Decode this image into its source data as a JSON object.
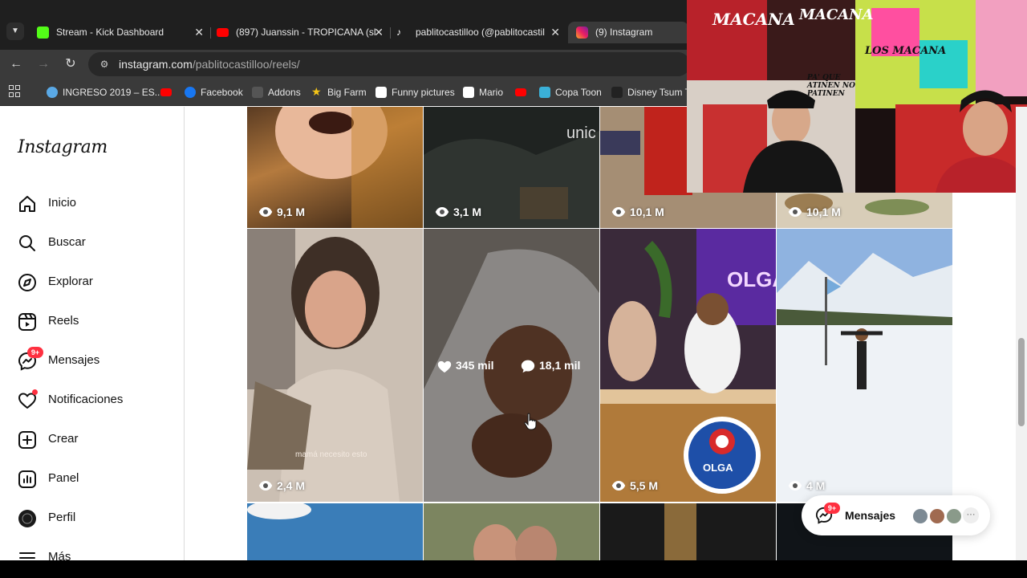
{
  "browser": {
    "tabs": [
      {
        "title": "Stream - Kick Dashboard",
        "favicon": "kick-logo-icon"
      },
      {
        "title": "(897) Juanssin - TROPICANA (sl",
        "favicon": "youtube-logo-icon"
      },
      {
        "title": "pablitocastilloo (@pablitocastil",
        "favicon": "tiktok-logo-icon"
      },
      {
        "title": "(9) Instagram",
        "favicon": "instagram-logo-icon"
      }
    ],
    "close_glyph": "✕",
    "address": {
      "domain": "instagram.com",
      "path": "/pablitocastilloo/reels/"
    },
    "bookmarks": [
      "INGRESO 2019 – ES...",
      "",
      "Facebook",
      "Addons",
      "Big Farm",
      "Funny pictures",
      "Mario",
      "",
      "Copa Toon",
      "Disney Tsum Ts"
    ]
  },
  "sidebar": {
    "logo": "Instagram",
    "items": [
      {
        "label": "Inicio",
        "icon": "home-icon"
      },
      {
        "label": "Buscar",
        "icon": "search-icon"
      },
      {
        "label": "Explorar",
        "icon": "compass-icon"
      },
      {
        "label": "Reels",
        "icon": "reels-icon"
      },
      {
        "label": "Mensajes",
        "icon": "messenger-icon",
        "badge": "9+"
      },
      {
        "label": "Notificaciones",
        "icon": "heart-icon"
      },
      {
        "label": "Crear",
        "icon": "plus-square-icon"
      },
      {
        "label": "Panel",
        "icon": "chart-icon"
      },
      {
        "label": "Perfil",
        "icon": "profile-avatar-icon"
      },
      {
        "label": "Más",
        "icon": "menu-icon"
      }
    ]
  },
  "reels": {
    "row1": [
      "9,1 M",
      "3,1 M",
      "10,1 M",
      "10,1 M"
    ],
    "row2": [
      "2,4 M",
      "",
      "5,5 M",
      "4 M"
    ],
    "hover": {
      "likes": "345 mil",
      "comments": "18,1 mil"
    },
    "caption": "mamá necesito esto",
    "olga_sign": "OLGA",
    "olga_badge": "OLGA",
    "unicef_text": "unic"
  },
  "webcam": {
    "banner_texts": [
      "MACANA",
      "MACANA",
      "LOS MACANA",
      "PA' QUE ATINEN NO PATINEN"
    ]
  },
  "messages_pill": {
    "label": "Mensajes",
    "badge": "9+",
    "more": "···"
  },
  "colors": {
    "accent": "#ff3040",
    "chrome_dark": "#1f1f1f",
    "chrome_mid": "#3a3a3a"
  }
}
